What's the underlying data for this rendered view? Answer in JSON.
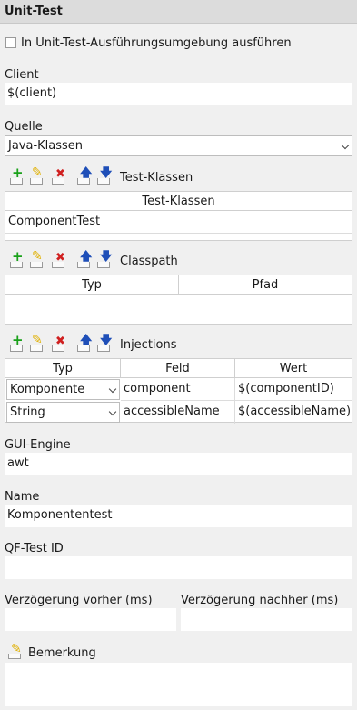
{
  "header": {
    "title": "Unit-Test"
  },
  "run_in_env": {
    "label": "In Unit-Test-Ausführungsumgebung ausführen",
    "checked": false
  },
  "client": {
    "label": "Client",
    "value": "$(client)"
  },
  "quelle": {
    "label": "Quelle",
    "selected": "Java-Klassen"
  },
  "test_klassen": {
    "toolbar_label": "Test-Klassen",
    "column": "Test-Klassen",
    "rows": [
      "ComponentTest"
    ]
  },
  "classpath": {
    "toolbar_label": "Classpath",
    "columns": [
      "Typ",
      "Pfad"
    ]
  },
  "injections": {
    "toolbar_label": "Injections",
    "columns": [
      "Typ",
      "Feld",
      "Wert"
    ],
    "rows": [
      {
        "typ": "Komponente",
        "feld": "component",
        "wert": "$(componentID)"
      },
      {
        "typ": "String",
        "feld": "accessibleName",
        "wert": "$(accessibleName)"
      }
    ]
  },
  "gui_engine": {
    "label": "GUI-Engine",
    "value": "awt"
  },
  "name": {
    "label": "Name",
    "value": "Komponententest"
  },
  "qftest_id": {
    "label": "QF-Test ID",
    "value": ""
  },
  "delay_before": {
    "label": "Verzögerung vorher (ms)",
    "value": ""
  },
  "delay_after": {
    "label": "Verzögerung nachher (ms)",
    "value": ""
  },
  "bemerkung": {
    "label": "Bemerkung",
    "value": ""
  },
  "icons": {
    "add": "plus-icon",
    "edit": "pencil-icon",
    "delete": "delete-x-icon",
    "up": "arrow-up-icon",
    "down": "arrow-down-icon"
  }
}
